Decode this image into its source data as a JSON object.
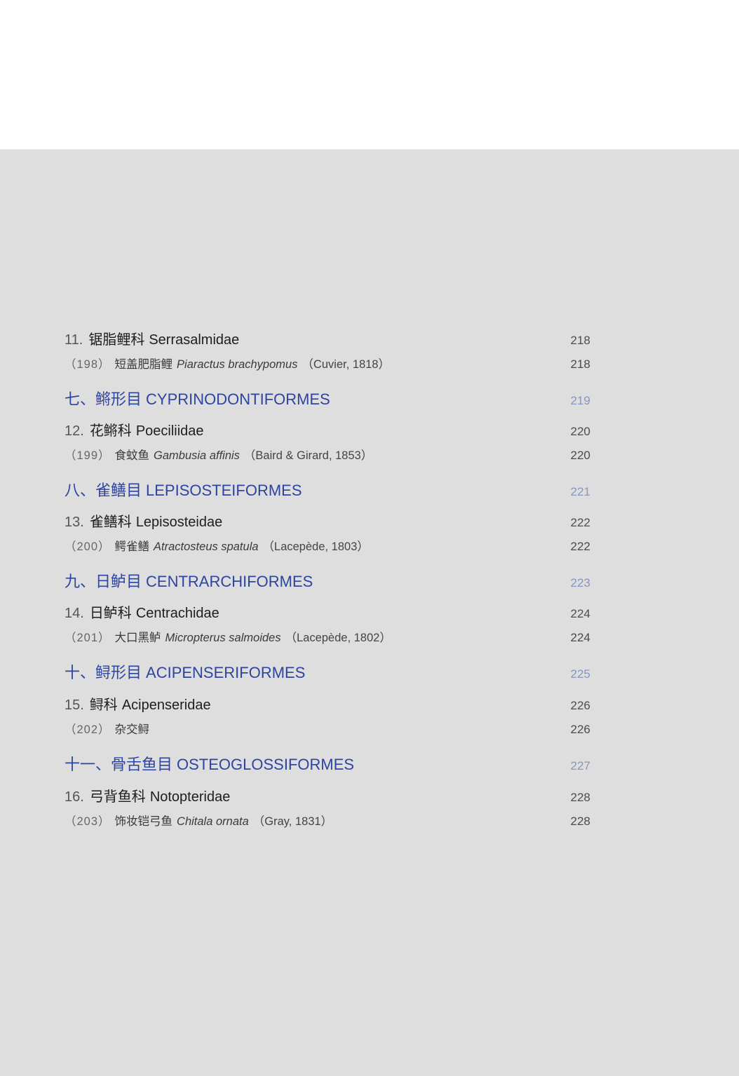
{
  "entries": [
    {
      "type": "family",
      "num": "11.",
      "cn": "锯脂鲤科",
      "latin": "Serrasalmidae",
      "page": "218"
    },
    {
      "type": "species",
      "num": "（198）",
      "cn": "短盖肥脂鲤",
      "sci": "Piaractus brachypomus",
      "author": "（Cuvier, 1818）",
      "page": "218"
    },
    {
      "type": "order",
      "cn": "七、鳉形目",
      "latin": "CYPRINODONTIFORMES",
      "page": "219"
    },
    {
      "type": "family",
      "num": "12.",
      "cn": "花鳉科",
      "latin": "Poeciliidae",
      "page": "220"
    },
    {
      "type": "species",
      "num": "（199）",
      "cn": "食蚊鱼",
      "sci": "Gambusia affinis",
      "author": "（Baird & Girard, 1853）",
      "page": "220"
    },
    {
      "type": "order",
      "cn": "八、雀鳝目",
      "latin": "LEPISOSTEIFORMES",
      "page": "221"
    },
    {
      "type": "family",
      "num": "13.",
      "cn": "雀鳝科",
      "latin": "Lepisosteidae",
      "page": "222"
    },
    {
      "type": "species",
      "num": "（200）",
      "cn": "鳄雀鳝",
      "sci": "Atractosteus spatula",
      "author": "（Lacepède, 1803）",
      "page": "222"
    },
    {
      "type": "order",
      "cn": "九、日鲈目",
      "latin": "CENTRARCHIFORMES",
      "page": "223"
    },
    {
      "type": "family",
      "num": "14.",
      "cn": "日鲈科",
      "latin": "Centrachidae",
      "page": "224"
    },
    {
      "type": "species",
      "num": "（201）",
      "cn": "大口黑鲈",
      "sci": "Micropterus salmoides",
      "author": "（Lacepède, 1802）",
      "page": "224"
    },
    {
      "type": "order",
      "cn": "十、鲟形目",
      "latin": "ACIPENSERIFORMES",
      "page": "225"
    },
    {
      "type": "family",
      "num": "15.",
      "cn": "鲟科",
      "latin": "Acipenseridae",
      "page": "226"
    },
    {
      "type": "species",
      "num": "（202）",
      "cn": "杂交鲟",
      "sci": "",
      "author": "",
      "page": "226"
    },
    {
      "type": "order",
      "cn": "十一、骨舌鱼目",
      "latin": "OSTEOGLOSSIFORMES",
      "page": "227"
    },
    {
      "type": "family",
      "num": "16.",
      "cn": "弓背鱼科",
      "latin": "Notopteridae",
      "page": "228"
    },
    {
      "type": "species",
      "num": "（203）",
      "cn": "饰妆铠弓鱼",
      "sci": "Chitala ornata",
      "author": "（Gray, 1831）",
      "page": "228"
    }
  ],
  "colors": {
    "order_text": "#2d44a0",
    "order_page": "#8a95bd",
    "body_background": "#dedede",
    "top_background": "#ffffff"
  }
}
